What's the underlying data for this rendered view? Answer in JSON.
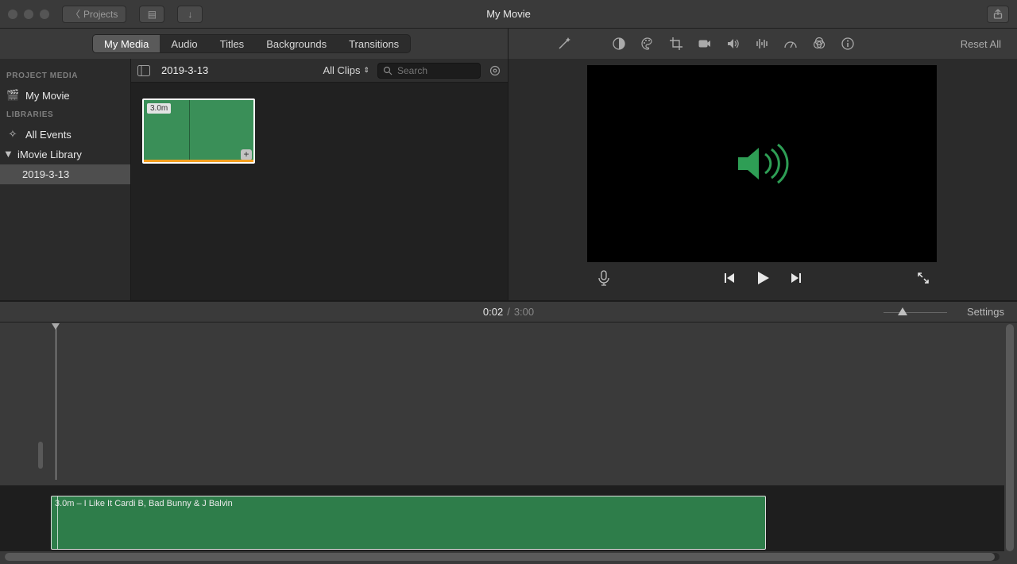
{
  "window": {
    "title": "My Movie",
    "back_label": "Projects"
  },
  "tabs": {
    "my_media": "My Media",
    "audio": "Audio",
    "titles": "Titles",
    "backgrounds": "Backgrounds",
    "transitions": "Transitions"
  },
  "preview_toolbar": {
    "reset": "Reset All"
  },
  "sidebar": {
    "project_media_header": "PROJECT MEDIA",
    "project_item": "My Movie",
    "libraries_header": "LIBRARIES",
    "all_events": "All Events",
    "library_name": "iMovie Library",
    "event_name": "2019-3-13"
  },
  "browser": {
    "title": "2019-3-13",
    "filter_label": "All Clips",
    "search_placeholder": "Search",
    "clip_duration": "3.0m"
  },
  "playhead": {
    "current": "0:02",
    "total": "3:00"
  },
  "settings_label": "Settings",
  "timeline": {
    "audio_clip_label": "3.0m – I Like It Cardi B, Bad Bunny & J Balvin"
  }
}
